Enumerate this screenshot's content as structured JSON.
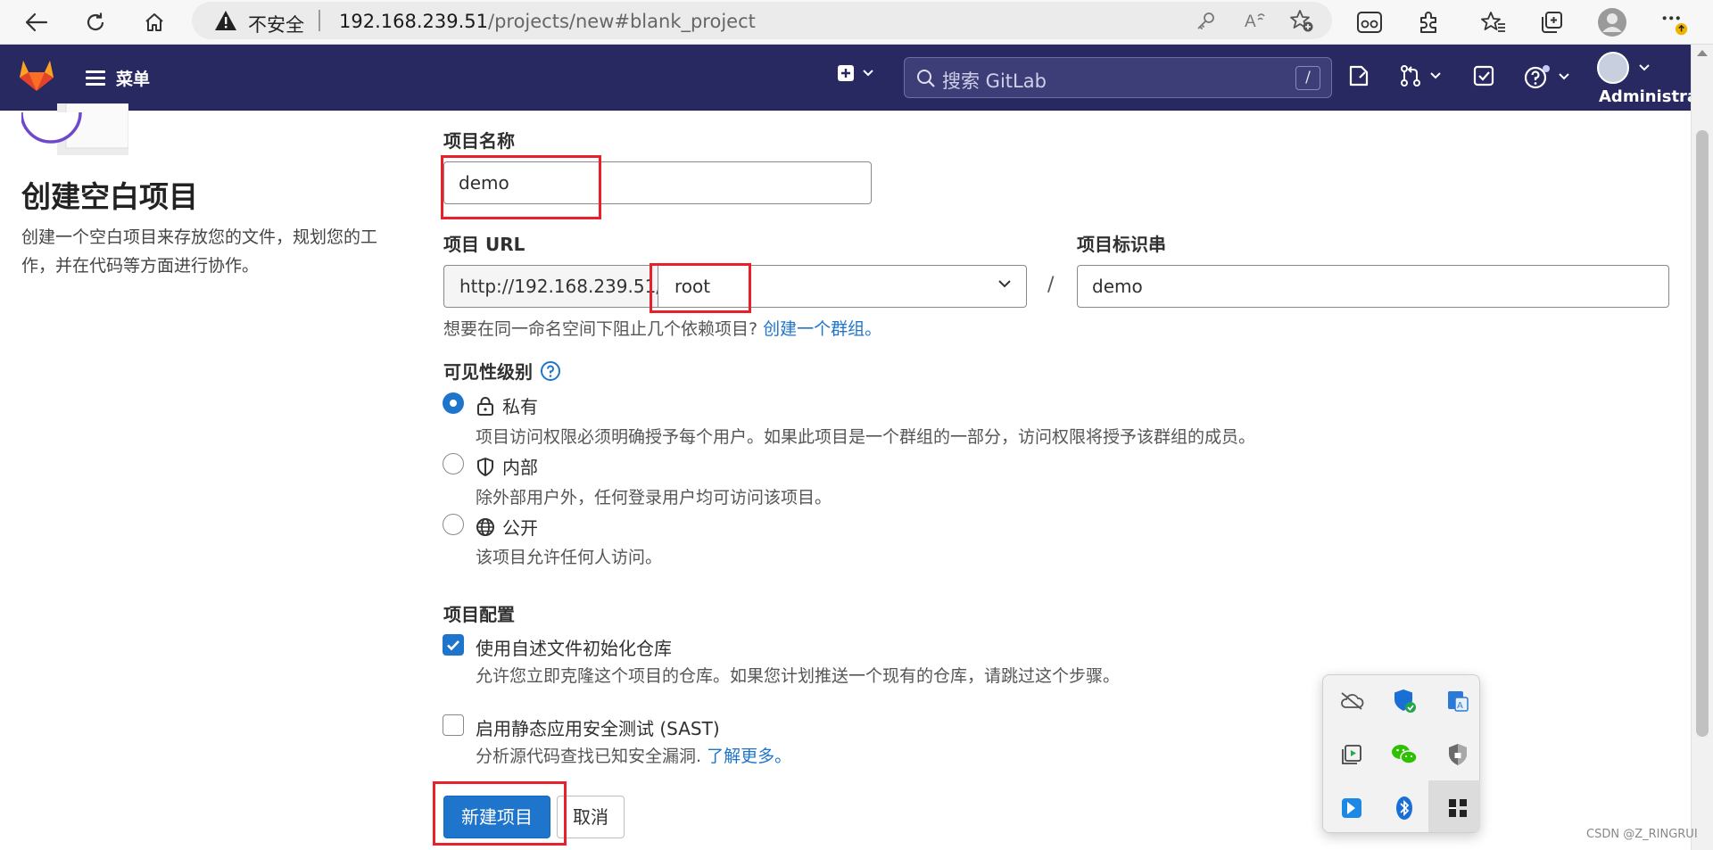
{
  "browser": {
    "insecure_label": "不安全",
    "url_host": "192.168.239.51",
    "url_path": "/projects/new#blank_project"
  },
  "header": {
    "menu_label": "菜单",
    "search_placeholder": "搜索 GitLab",
    "search_shortcut": "/",
    "user_name": "Administrator"
  },
  "left": {
    "title": "创建空白项目",
    "description": "创建一个空白项目来存放您的文件，规划您的工作，并在代码等方面进行协作。"
  },
  "form": {
    "project_name_label": "项目名称",
    "project_name_value": "demo",
    "project_url_label": "项目 URL",
    "url_prefix": "http://192.168.239.51/",
    "namespace_value": "root",
    "path_separator": "/",
    "project_slug_label": "项目标识串",
    "project_slug_value": "demo",
    "group_help_text": "想要在同一命名空间下阻止几个依赖项目?",
    "group_help_link": "创建一个群组。",
    "visibility_label": "可见性级别",
    "visibility_options": [
      {
        "label": "私有",
        "description": "项目访问权限必须明确授予每个用户。如果此项目是一个群组的一部分，访问权限将授予该群组的成员。",
        "selected": true
      },
      {
        "label": "内部",
        "description": "除外部用户外，任何登录用户均可访问该项目。",
        "selected": false
      },
      {
        "label": "公开",
        "description": "该项目允许任何人访问。",
        "selected": false
      }
    ],
    "config_label": "项目配置",
    "init_readme_label": "使用自述文件初始化仓库",
    "init_readme_desc": "允许您立即克隆这个项目的仓库。如果您计划推送一个现有的仓库，请跳过这个步骤。",
    "init_readme_checked": true,
    "sast_label": "启用静态应用安全测试 (SAST)",
    "sast_desc": "分析源代码查找已知安全漏洞.",
    "sast_link": "了解更多。",
    "sast_checked": false,
    "create_button": "新建项目",
    "cancel_button": "取消"
  },
  "watermark": "CSDN @Z_RINGRUI",
  "colors": {
    "header_bg": "#292961",
    "primary": "#1f75cb",
    "highlight_red": "#e8202a"
  }
}
